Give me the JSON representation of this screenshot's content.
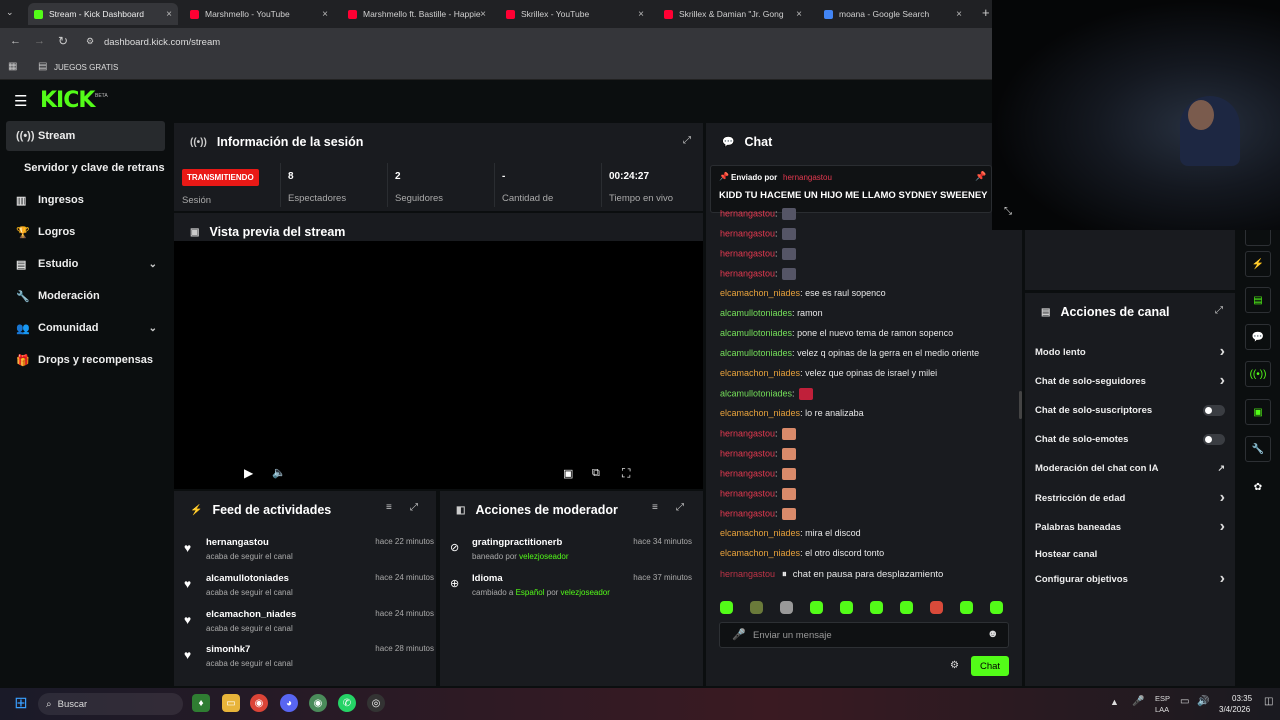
{
  "browser": {
    "tabs": [
      {
        "title": "Stream - Kick Dashboard",
        "fav": "#53fc18"
      },
      {
        "title": "Marshmello - YouTube",
        "fav": "#ff0033"
      },
      {
        "title": "Marshmello ft. Bastille - Happie",
        "fav": "#ff0033"
      },
      {
        "title": "Skrillex - YouTube",
        "fav": "#ff0033"
      },
      {
        "title": "Skrillex & Damian \"Jr. Gong",
        "fav": "#ff0033"
      },
      {
        "title": "moana - Google Search",
        "fav": "#4285f4"
      }
    ],
    "url": "dashboard.kick.com/stream",
    "bookmark": "JUEGOS GRATIS"
  },
  "logo": "KICK",
  "logo_beta": "BETA",
  "sidebar": {
    "items": [
      {
        "label": "Stream",
        "icon": "broadcast-icon"
      },
      {
        "label": "Servidor y clave de retransmisión",
        "icon": ""
      },
      {
        "label": "Ingresos",
        "icon": "bars-icon"
      },
      {
        "label": "Logros",
        "icon": "trophy-icon"
      },
      {
        "label": "Estudio",
        "icon": "studio-icon"
      },
      {
        "label": "Moderación",
        "icon": "wrench-icon"
      },
      {
        "label": "Comunidad",
        "icon": "people-icon"
      },
      {
        "label": "Drops y recompensas",
        "icon": "gift-icon"
      }
    ]
  },
  "session": {
    "title": "Información de la sesión",
    "status": "TRANSMITIENDO",
    "status_sub": "Sesión",
    "stats": [
      {
        "value": "8",
        "label": "Espectadores"
      },
      {
        "value": "2",
        "label": "Seguidores"
      },
      {
        "value": "-",
        "label": "Cantidad de"
      },
      {
        "value": "00:24:27",
        "label": "Tiempo en vivo"
      }
    ]
  },
  "preview": {
    "title": "Vista previa del stream"
  },
  "feed": {
    "title": "Feed de actividades",
    "rows": [
      {
        "name": "hernangastou",
        "desc": "acaba de seguir el canal",
        "time": "hace 22 minutos"
      },
      {
        "name": "alcamullotoniades",
        "desc": "acaba de seguir el canal",
        "time": "hace 24 minutos"
      },
      {
        "name": "elcamachon_niades",
        "desc": "acaba de seguir el canal",
        "time": "hace 24 minutos"
      },
      {
        "name": "simonhk7",
        "desc": "acaba de seguir el canal",
        "time": "hace 28 minutos"
      }
    ]
  },
  "modactions": {
    "title": "Acciones de moderador",
    "rows": [
      {
        "name": "gratingpractitionerb",
        "pre": "baneado por",
        "by": "velezjoseador",
        "time": "hace 34 minutos",
        "icon": "ban-icon"
      },
      {
        "name": "Idioma",
        "pre": "cambiado a",
        "lang": "Español",
        "mid": "por",
        "by": "velezjoseador",
        "time": "hace 37 minutos",
        "icon": "globe-icon"
      }
    ]
  },
  "chat": {
    "title": "Chat",
    "pinned_by_label": "Enviado por",
    "pinned_by": "hernangastou",
    "pinned_msg": "KIDD TU HACEME UN HIJO ME LLAMO SYDNEY SWEENEY",
    "messages": [
      {
        "user": "hernangastou",
        "color": "red",
        "text": "",
        "emote": "#556"
      },
      {
        "user": "hernangastou",
        "color": "red",
        "text": "",
        "emote": "#556"
      },
      {
        "user": "hernangastou",
        "color": "red",
        "text": "",
        "emote": "#556"
      },
      {
        "user": "hernangastou",
        "color": "red",
        "text": "",
        "emote": "#556"
      },
      {
        "user": "elcamachon_niades",
        "color": "orange",
        "text": "ese es raul sopenco"
      },
      {
        "user": "alcamullotoniades",
        "color": "green",
        "text": "ramon"
      },
      {
        "user": "alcamullotoniades",
        "color": "green",
        "text": "pone el nuevo tema de ramon sopenco"
      },
      {
        "user": "alcamullotoniades",
        "color": "green",
        "text": "velez q opinas de la gerra en el medio oriente"
      },
      {
        "user": "elcamachon_niades",
        "color": "orange",
        "text": "velez que opinas de israel y milei"
      },
      {
        "user": "alcamullotoniades",
        "color": "green",
        "text": "",
        "emote": "#c0203a"
      },
      {
        "user": "elcamachon_niades",
        "color": "orange",
        "text": "lo re analizaba"
      },
      {
        "user": "hernangastou",
        "color": "red",
        "text": "",
        "emote": "#d98a6a"
      },
      {
        "user": "hernangastou",
        "color": "red",
        "text": "",
        "emote": "#d98a6a"
      },
      {
        "user": "hernangastou",
        "color": "red",
        "text": "",
        "emote": "#d98a6a"
      },
      {
        "user": "hernangastou",
        "color": "red",
        "text": "",
        "emote": "#d98a6a"
      },
      {
        "user": "hernangastou",
        "color": "red",
        "text": "",
        "emote": "#d98a6a"
      },
      {
        "user": "elcamachon_niades",
        "color": "orange",
        "text": "mira el discod"
      },
      {
        "user": "elcamachon_niades",
        "color": "orange",
        "text": "el otro discord tonto"
      }
    ],
    "last_user": "hernangastou",
    "paused": "chat en pausa para desplazamiento",
    "placeholder": "Enviar un mensaje",
    "send": "Chat"
  },
  "channel": {
    "title": "Acciones de canal",
    "rows": [
      {
        "label": "Modo lento",
        "ctl": "arrow"
      },
      {
        "label": "Chat de solo-seguidores",
        "ctl": "arrow"
      },
      {
        "label": "Chat de solo-suscriptores",
        "ctl": "toggle"
      },
      {
        "label": "Chat de solo-emotes",
        "ctl": "toggle"
      },
      {
        "label": "Moderación del chat con IA",
        "ctl": "ext"
      },
      {
        "label": "Restricción de edad",
        "ctl": "arrow"
      },
      {
        "label": "Palabras baneadas",
        "ctl": "arrow"
      },
      {
        "label": "Hostear canal",
        "ctl": ""
      },
      {
        "label": "Configurar objetivos",
        "ctl": "arrow"
      }
    ]
  },
  "taskbar": {
    "search": "Buscar",
    "lang": "ESP",
    "lang2": "LAA",
    "time": "03:35",
    "date": "3/4/2026"
  },
  "colors": {
    "kick": "#53fc18",
    "live": "#e91916",
    "panel": "#191b1f"
  }
}
